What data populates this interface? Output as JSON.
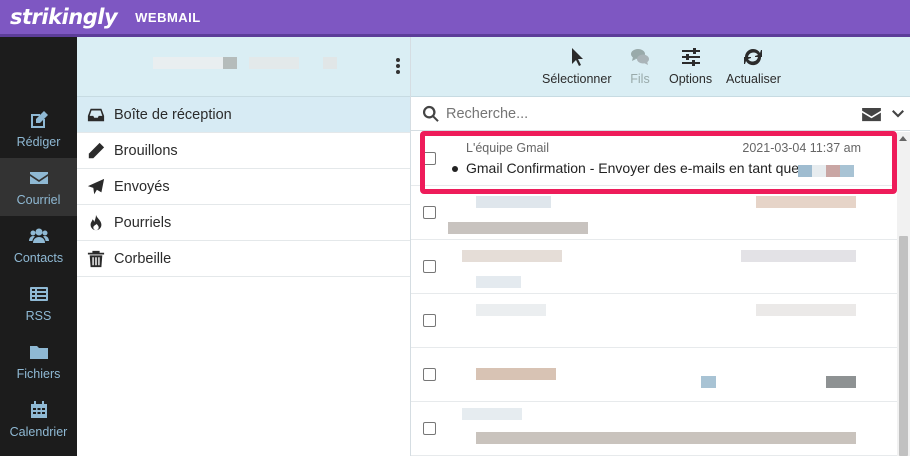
{
  "app": {
    "brand": "strikingly",
    "product": "WEBMAIL"
  },
  "nav": [
    {
      "label": "Rédiger",
      "icon": "compose-icon"
    },
    {
      "label": "Courriel",
      "icon": "envelope-icon",
      "active": true
    },
    {
      "label": "Contacts",
      "icon": "contacts-icon"
    },
    {
      "label": "RSS",
      "icon": "rss-icon"
    },
    {
      "label": "Fichiers",
      "icon": "folder-icon"
    },
    {
      "label": "Calendrier",
      "icon": "calendar-icon"
    }
  ],
  "folders": [
    {
      "label": "Boîte de réception",
      "icon": "inbox-icon",
      "active": true
    },
    {
      "label": "Brouillons",
      "icon": "pencil-icon"
    },
    {
      "label": "Envoyés",
      "icon": "paper-plane-icon"
    },
    {
      "label": "Pourriels",
      "icon": "fire-icon"
    },
    {
      "label": "Corbeille",
      "icon": "trash-icon"
    }
  ],
  "toolbar": {
    "select": "Sélectionner",
    "threads": "Fils",
    "options": "Options",
    "refresh": "Actualiser"
  },
  "search": {
    "placeholder": "Recherche..."
  },
  "messages": [
    {
      "from": "L'équipe Gmail",
      "date": "2021-03-04 11:37 am",
      "subject": "Gmail Confirmation - Envoyer des e-mails en tant que",
      "unread": true,
      "highlighted": true
    }
  ],
  "colors": {
    "header": "#7e57c2",
    "highlight": "#ee1c5a",
    "nav_bg": "#1c1c1c",
    "pane_header": "#daeef4"
  }
}
